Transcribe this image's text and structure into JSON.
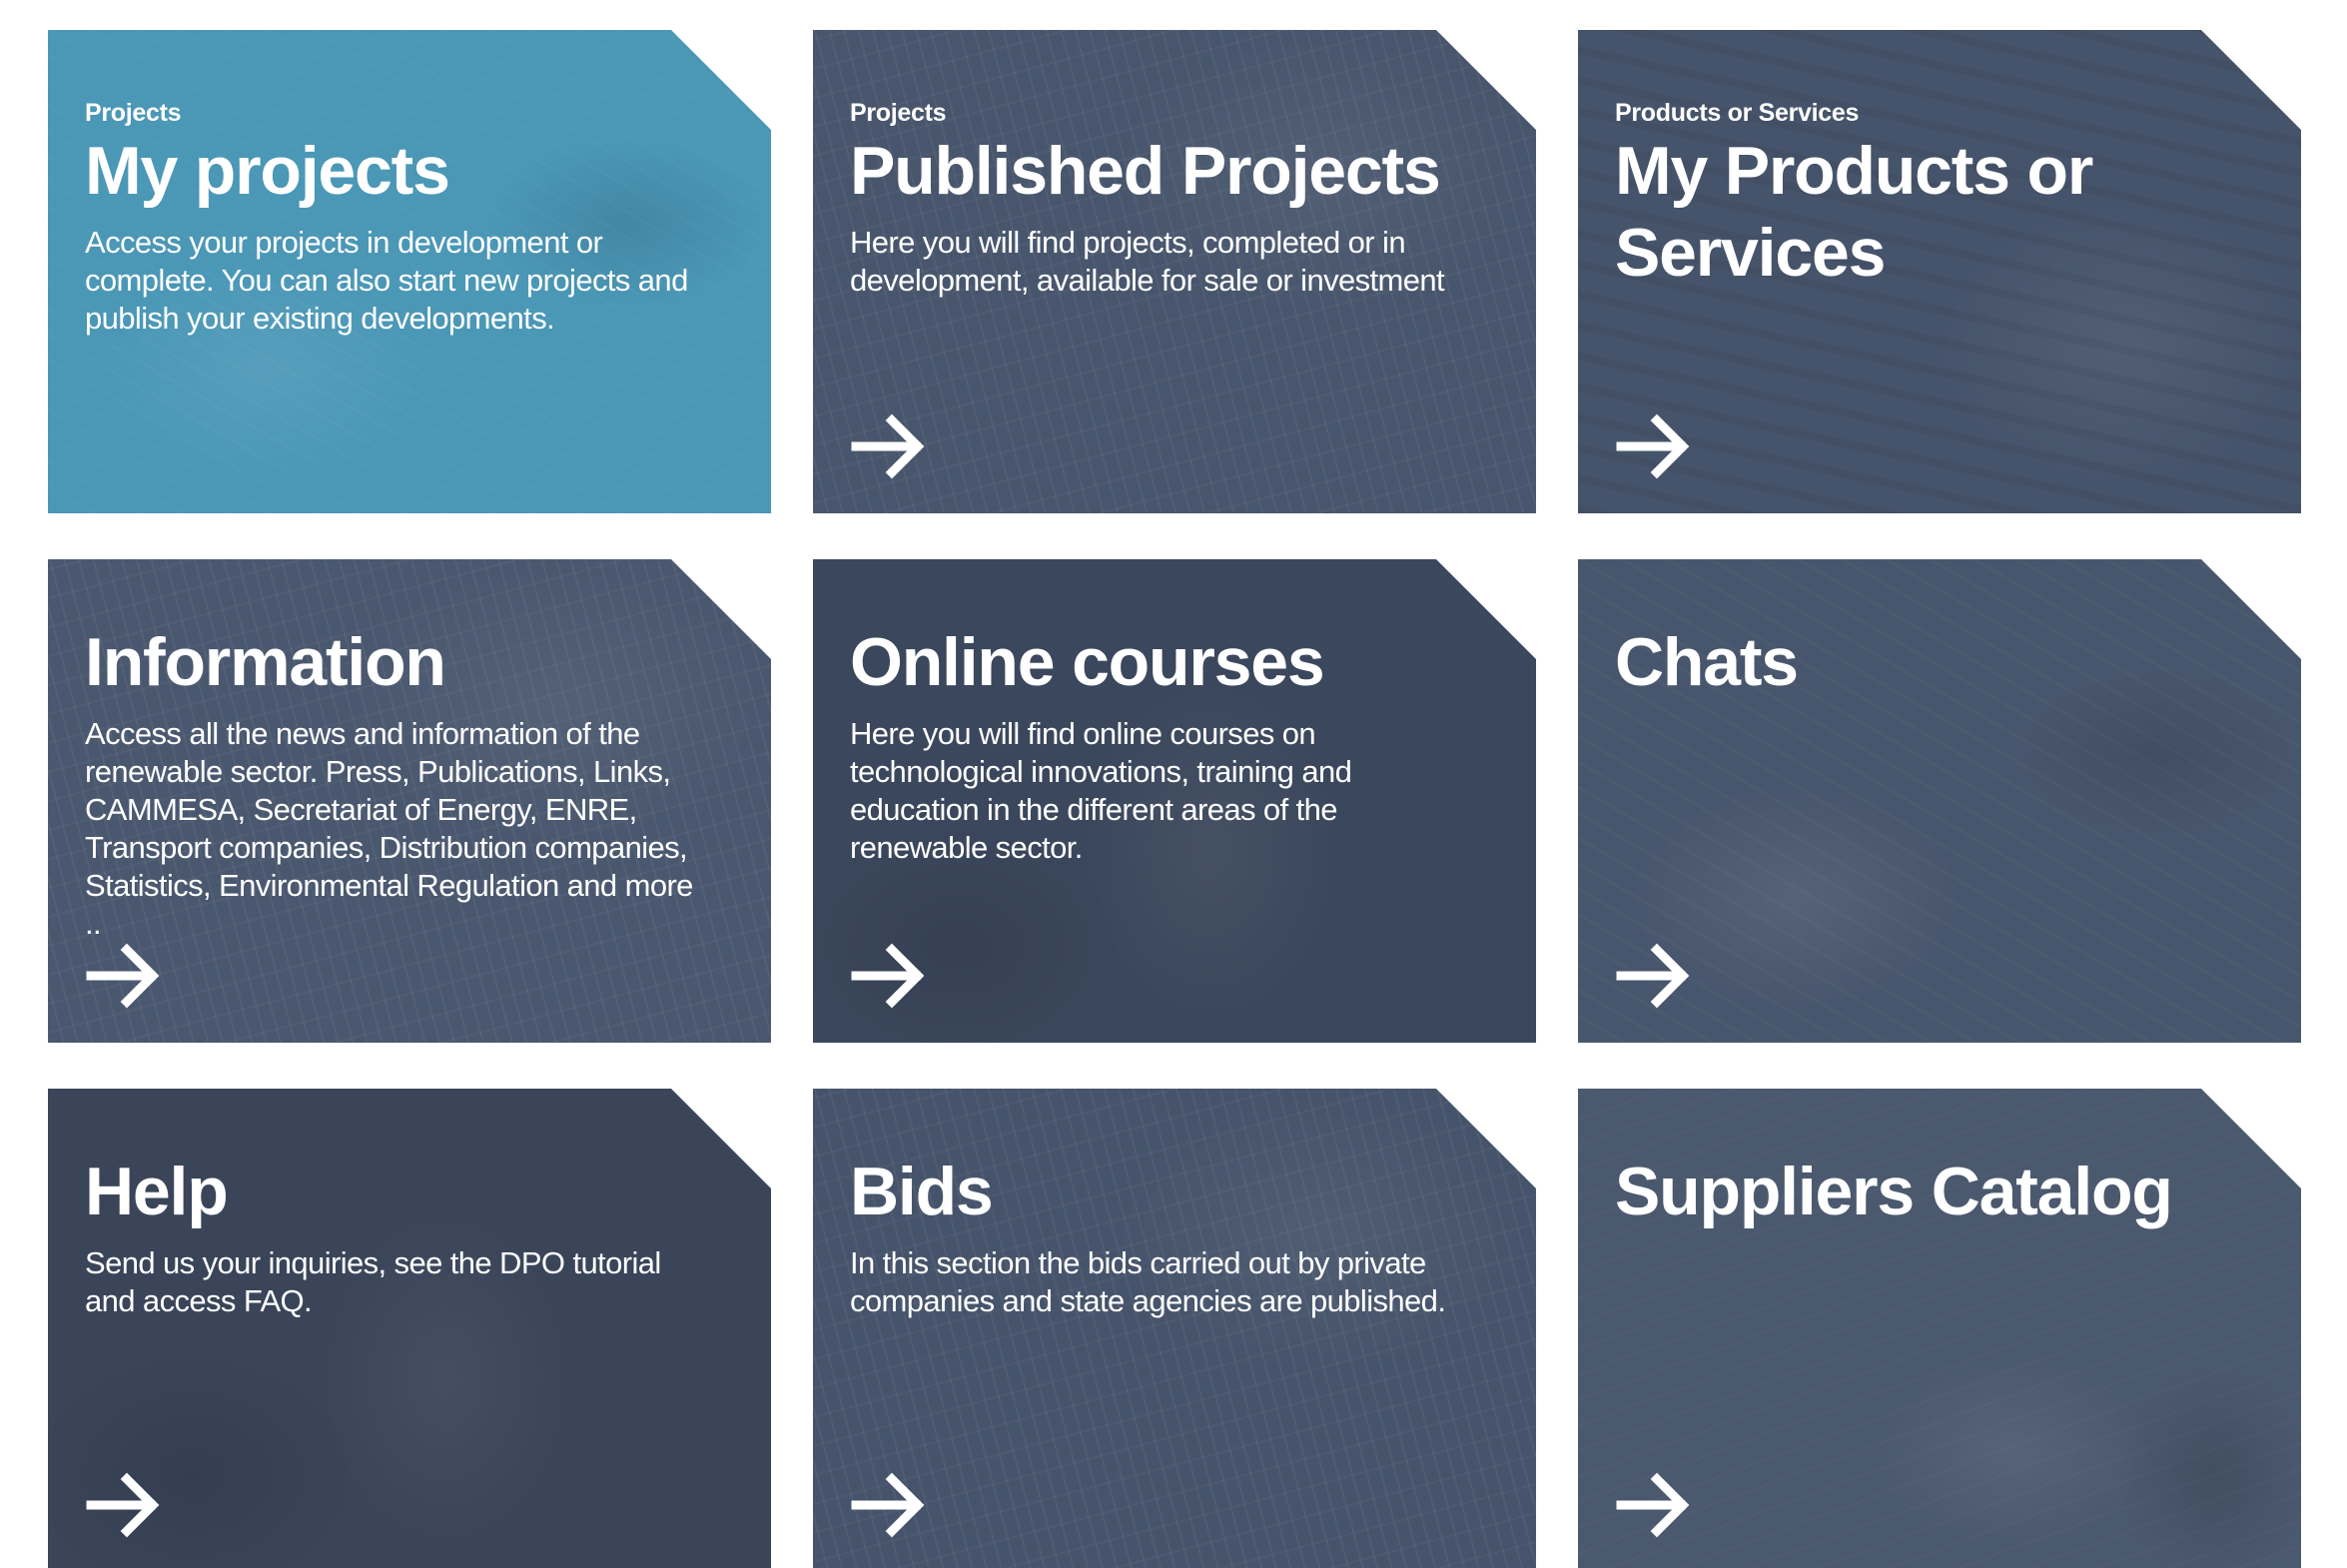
{
  "colors": {
    "accent_tile": "#4a97b6",
    "slate_tile": "#46546b",
    "dark_tile": "#3a4559",
    "text": "#ffffff"
  },
  "tiles": [
    {
      "eyebrow": "Projects",
      "title": "My projects",
      "description": "Access your projects in development or complete. You can also start new projects and publish your existing developments.",
      "icon": "arrow-right-icon"
    },
    {
      "eyebrow": "Projects",
      "title": "Published Projects",
      "description": "Here you will find projects, completed or in development, available for sale or investment",
      "icon": "arrow-right-icon"
    },
    {
      "eyebrow": "Products or Services",
      "title": "My Products or Services",
      "description": "",
      "icon": "arrow-right-icon"
    },
    {
      "eyebrow": "",
      "title": "Information",
      "description": "Access all the news and information of the renewable sector. Press, Publications, Links, CAMMESA, Secretariat of Energy, ENRE, Transport companies, Distribution companies, Statistics, Environmental Regulation and more ..",
      "icon": "arrow-right-icon"
    },
    {
      "eyebrow": "",
      "title": "Online courses",
      "description": "Here you will find online courses on technological innovations, training and education in the different areas of the renewable sector.",
      "icon": "arrow-right-icon"
    },
    {
      "eyebrow": "",
      "title": "Chats",
      "description": "",
      "icon": "arrow-right-icon"
    },
    {
      "eyebrow": "",
      "title": "Help",
      "description": "Send us your inquiries, see the DPO tutorial and access FAQ.",
      "icon": "arrow-right-icon"
    },
    {
      "eyebrow": "",
      "title": "Bids",
      "description": "In this section the bids carried out by private companies and state agencies are published.",
      "icon": "arrow-right-icon"
    },
    {
      "eyebrow": "",
      "title": "Suppliers Catalog",
      "description": "",
      "icon": "arrow-right-icon"
    }
  ]
}
